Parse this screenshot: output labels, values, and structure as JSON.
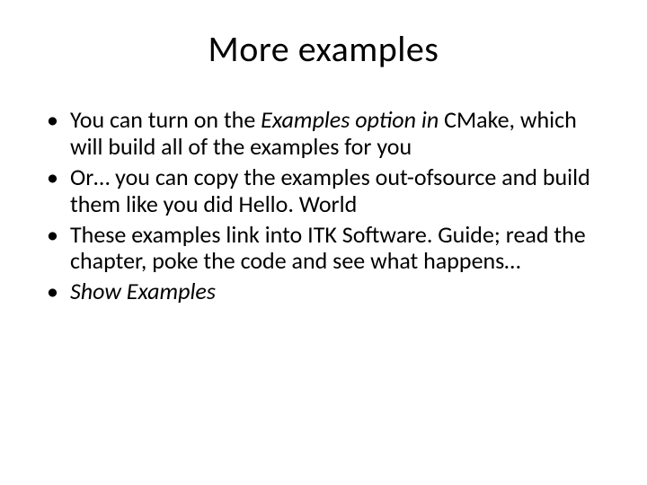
{
  "title": "More examples",
  "bullets": [
    {
      "pre": "You can turn on the ",
      "em": "Examples option in ",
      "post": "CMake, which will build all of the examples for you"
    },
    {
      "pre": "Or… you can copy the examples out-ofsource and build them like you did Hello. World",
      "em": "",
      "post": ""
    },
    {
      "pre": "These examples link into ITK Software. Guide; read the chapter, poke the code and see what happens…",
      "em": "",
      "post": ""
    },
    {
      "pre": "",
      "em": "Show Examples",
      "post": ""
    }
  ]
}
